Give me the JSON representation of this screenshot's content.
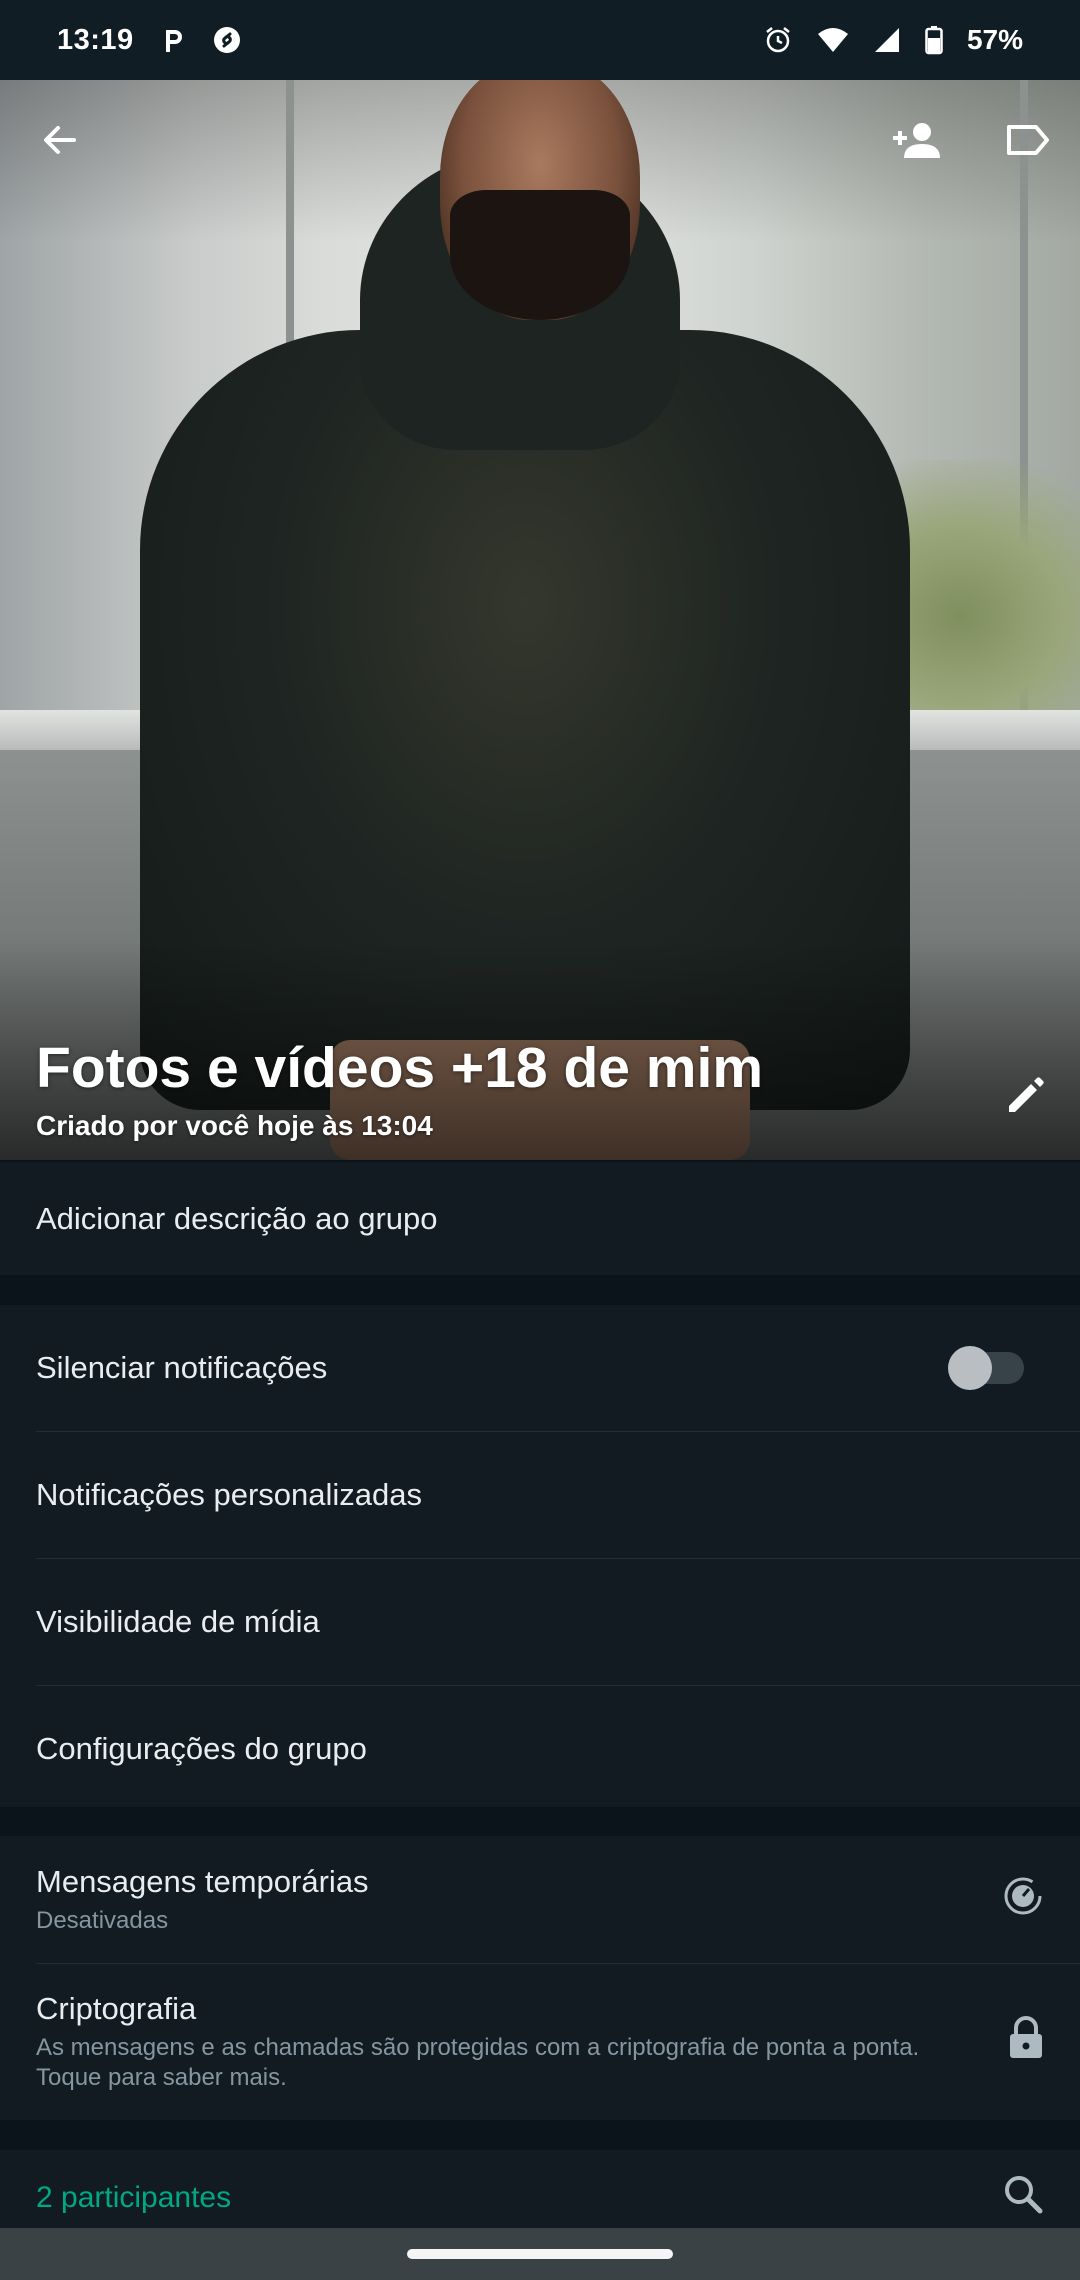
{
  "status_bar": {
    "time": "13:19",
    "battery": "57%",
    "icons": [
      "p-app-icon",
      "shazam-icon",
      "alarm-icon",
      "wifi-icon",
      "signal-icon",
      "battery-icon"
    ]
  },
  "header": {
    "back_icon": "arrow-back-icon",
    "add_participant_icon": "person-add-icon",
    "label_icon": "label-icon",
    "edit_icon": "pencil-icon"
  },
  "group": {
    "title": "Fotos e vídeos +18 de mim",
    "created": "Criado por você hoje às 13:04"
  },
  "description": {
    "label": "Adicionar descrição ao grupo"
  },
  "settings": {
    "mute_label": "Silenciar notificações",
    "mute_enabled": false,
    "custom_notifications": "Notificações personalizadas",
    "media_visibility": "Visibilidade de mídia",
    "group_settings": "Configurações do grupo"
  },
  "privacy": {
    "disappearing_title": "Mensagens temporárias",
    "disappearing_status": "Desativadas",
    "encryption_title": "Criptografia",
    "encryption_desc": "As mensagens e as chamadas são protegidas com a criptografia de ponta a ponta. Toque para saber mais."
  },
  "participants": {
    "count_label": "2 participantes"
  },
  "colors": {
    "accent": "#00a884",
    "background": "#0b141a",
    "card": "#111b21",
    "secondary_text": "#8696a0"
  }
}
